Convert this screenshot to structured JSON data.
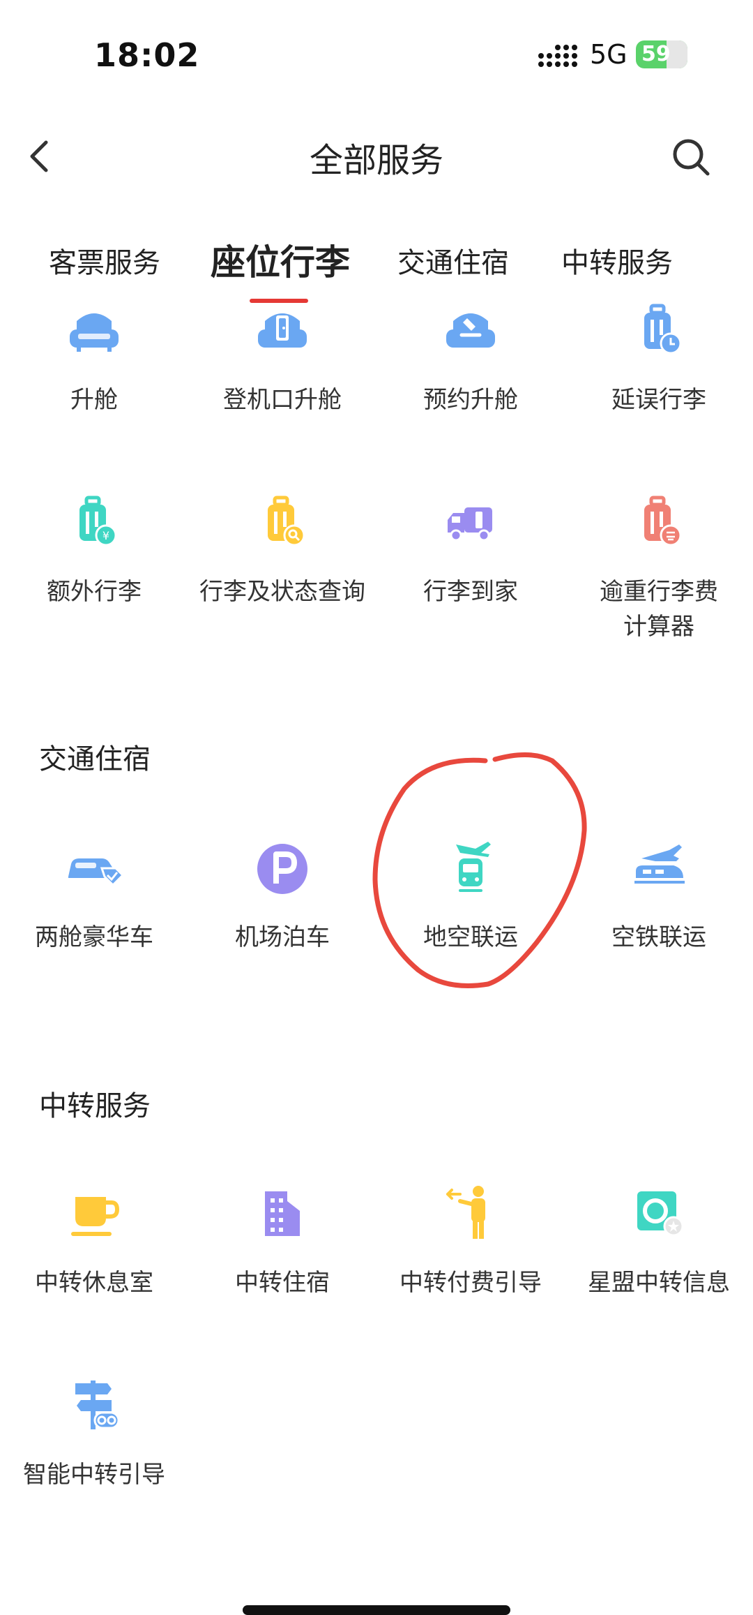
{
  "status_bar": {
    "time": "18:02",
    "network": "5G",
    "battery": "59",
    "battery_level": 0.59
  },
  "nav": {
    "title": "全部服务",
    "back_icon": "chevron-left-icon",
    "search_icon": "search-icon"
  },
  "tabs": [
    {
      "label": "客票服务",
      "active": false
    },
    {
      "label": "座位行李",
      "active": true
    },
    {
      "label": "交通住宿",
      "active": false
    },
    {
      "label": "中转服务",
      "active": false
    }
  ],
  "seat_baggage": {
    "items": [
      {
        "label": "升舱",
        "icon": "seat-upgrade-icon"
      },
      {
        "label": "登机口升舱",
        "icon": "gate-upgrade-icon"
      },
      {
        "label": "预约升舱",
        "icon": "reserve-upgrade-icon"
      },
      {
        "label": "延误行李",
        "icon": "delayed-baggage-icon"
      },
      {
        "label": "额外行李",
        "icon": "extra-baggage-icon"
      },
      {
        "label": "行李及状态查询",
        "icon": "baggage-search-icon"
      },
      {
        "label": "行李到家",
        "icon": "baggage-delivery-icon"
      },
      {
        "label": "逾重行李费计算器",
        "label_line1": "逾重行李费",
        "label_line2": "计算器",
        "icon": "excess-baggage-calculator-icon"
      }
    ]
  },
  "transport": {
    "title": "交通住宿",
    "items": [
      {
        "label": "两舱豪华车",
        "icon": "luxury-car-icon"
      },
      {
        "label": "机场泊车",
        "icon": "parking-icon"
      },
      {
        "label": "地空联运",
        "icon": "ground-air-transport-icon"
      },
      {
        "label": "空铁联运",
        "icon": "air-rail-icon"
      }
    ]
  },
  "transfer": {
    "title": "中转服务",
    "items": [
      {
        "label": "中转休息室",
        "icon": "coffee-cup-icon"
      },
      {
        "label": "中转住宿",
        "icon": "hotel-icon"
      },
      {
        "label": "中转付费引导",
        "icon": "guide-person-icon"
      },
      {
        "label": "星盟中转信息",
        "icon": "star-alliance-icon"
      },
      {
        "label": "智能中转引导",
        "icon": "signpost-icon"
      }
    ]
  },
  "colors": {
    "blue": "#6aa7f2",
    "teal": "#3fd6c3",
    "yellow": "#ffca3a",
    "purple": "#9a8cf0",
    "coral": "#f08074",
    "active_indicator": "#e53935",
    "annotation": "#e8483d"
  }
}
